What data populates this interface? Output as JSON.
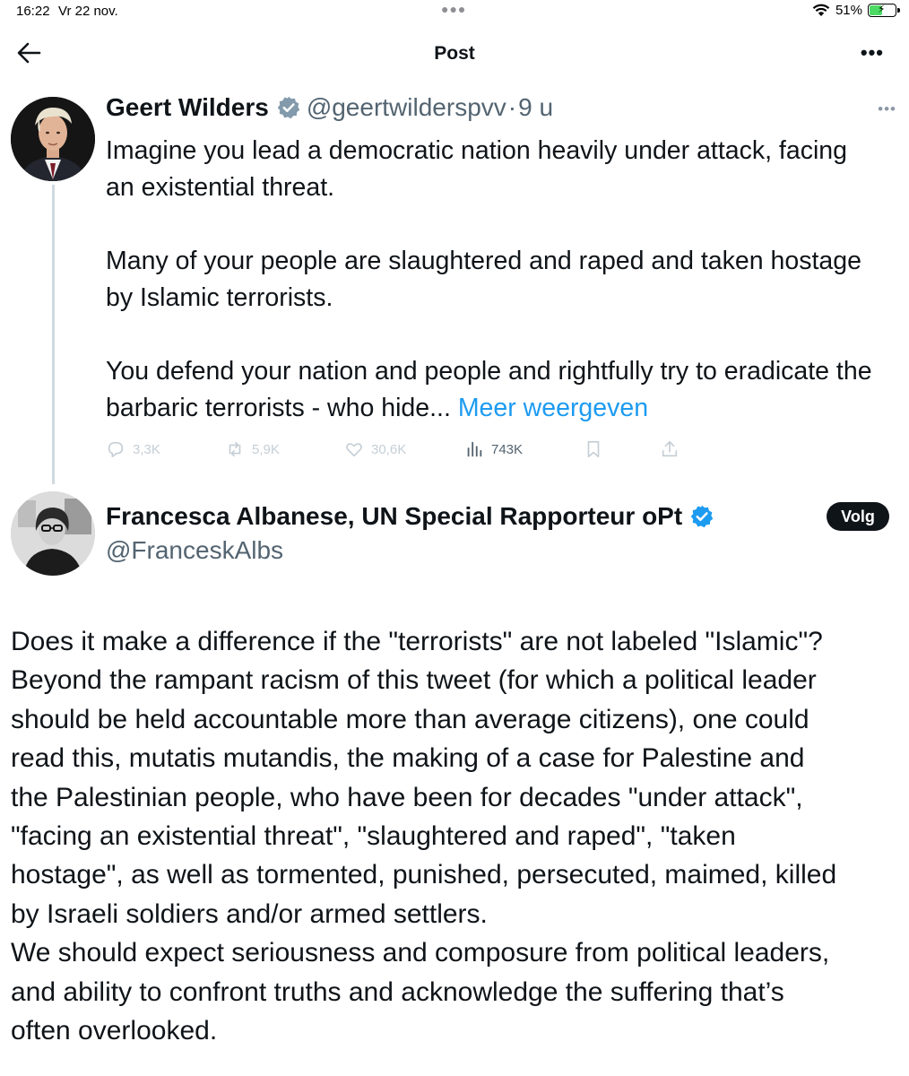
{
  "status_bar": {
    "time": "16:22",
    "date": "Vr 22 nov.",
    "battery": "51%",
    "battery_level": 0.51
  },
  "nav": {
    "title": "Post"
  },
  "tweet1": {
    "name": "Geert Wilders",
    "handle": "@geertwilderspvv",
    "separator": "·",
    "time": "9 u",
    "lines": [
      "Imagine you lead a democratic nation heavily under attack, facing",
      "an existential threat.",
      "",
      "Many of your people are slaughtered and raped and taken hostage",
      "by Islamic terrorists.",
      "",
      "You defend your nation and people and rightfully try to eradicate the"
    ],
    "last_line": "barbaric terrorists - who hide...",
    "show_more": "Meer weergeven",
    "replies": "3,3K",
    "reposts": "5,9K",
    "likes": "30,6K",
    "views": "743K"
  },
  "tweet2": {
    "name": "Francesca Albanese, UN Special Rapporteur oPt",
    "handle": "@FranceskAlbs",
    "follow_label": "Volg",
    "lines": [
      "Does it make a difference if the \"terrorists\" are not labeled \"Islamic\"?",
      "Beyond the rampant racism of this tweet (for which a political leader",
      "should be held accountable more than average citizens), one could",
      "read this, mutatis mutandis, the making of a case for Palestine and",
      "the Palestinian people, who have been for decades \"under attack\",",
      "\"facing an existential threat\", \"slaughtered and raped\", \"taken",
      "hostage\", as well as tormented, punished, persecuted, maimed, killed",
      "by Israeli soldiers and/or armed settlers.",
      "We should expect seriousness and composure from political leaders,",
      "and ability to confront truths and acknowledge the suffering that’s",
      "often overlooked."
    ]
  },
  "colors": {
    "text": "#0f1419",
    "secondary": "#536471",
    "link": "#1d9bf0",
    "verified_blue": "#1d9bf0",
    "verified_grey": "#829aab",
    "battery_green": "#4cd964"
  }
}
